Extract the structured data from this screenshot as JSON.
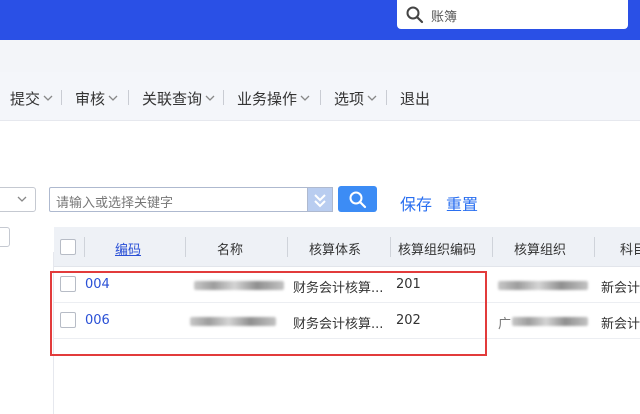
{
  "header": {
    "search_placeholder": "账簿"
  },
  "toolbar": {
    "items": [
      {
        "label": "提交",
        "has_dropdown": true
      },
      {
        "label": "审核",
        "has_dropdown": true
      },
      {
        "label": "关联查询",
        "has_dropdown": true
      },
      {
        "label": "业务操作",
        "has_dropdown": true
      },
      {
        "label": "选项",
        "has_dropdown": true
      },
      {
        "label": "退出",
        "has_dropdown": false
      }
    ]
  },
  "filter": {
    "keyword_placeholder": "请输入或选择关键字",
    "save_label": "保存",
    "reset_label": "重置"
  },
  "grid": {
    "columns": [
      "编码",
      "名称",
      "核算体系",
      "核算组织编码",
      "核算组织",
      "科目"
    ],
    "rows": [
      {
        "code": "004",
        "system": "财务会计核算...",
        "org_code": "201",
        "account": "新会计"
      },
      {
        "code": "006",
        "system": "财务会计核算...",
        "org_code": "202",
        "org_prefix": "广",
        "account": "新会计"
      }
    ]
  },
  "colors": {
    "topbar": "#2a50e6",
    "accent": "#3c8cf5",
    "link": "#2a6ff0",
    "highlight": "#e23b3b"
  },
  "icons": [
    "search-icon",
    "chevron-down-icon",
    "double-chevron-down-icon"
  ]
}
